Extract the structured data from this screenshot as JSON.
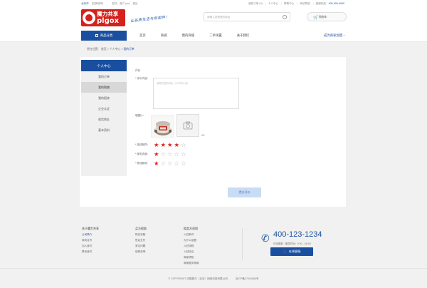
{
  "topbar": {
    "city": "北京市",
    "switch_city": "[切换城市]",
    "welcome": "您好，用户 (sn)",
    "logout": "退出",
    "my_orders": "我的订单 (0)",
    "personal_center": "个人中心",
    "help_center": "帮助中心",
    "network_nav": "网站导航",
    "hotline_label": "客服热线：",
    "hotline": "400-400-4000"
  },
  "header": {
    "logo_cn": "魔力共享",
    "logo_en": "plgox",
    "slogan": "让品质生活与你相伴！",
    "search_placeholder": "请输入您想找的商品",
    "cart_label": "购物车"
  },
  "nav": {
    "category_label": "商品分类",
    "links": [
      "首页",
      "商城",
      "我的商城",
      "二手闲置",
      "关于我们"
    ],
    "business_link": "成为商家加盟"
  },
  "breadcrumb": {
    "prefix": "所在位置：",
    "home": "首页",
    "sep": ">",
    "personal": "个人中心",
    "current": "我的订单"
  },
  "sidebar": {
    "title": "个人中心",
    "items": [
      {
        "label": "我的订单"
      },
      {
        "label": "我的购物"
      },
      {
        "label": "我的报修"
      },
      {
        "label": "企业认证"
      },
      {
        "label": "收货地址"
      },
      {
        "label": "基本资料"
      }
    ]
  },
  "form": {
    "section_title": "评价",
    "content_label": "* 评价内容：",
    "content_placeholder": "请填写您的评价（200字以内）",
    "image_label": "晒图片：",
    "image_count": "0/5",
    "ratings": [
      {
        "label": "* 描述相符：",
        "value": 4,
        "max": 5
      },
      {
        "label": "* 服务态度：",
        "value": 1,
        "max": 5
      },
      {
        "label": "* 物流服务：",
        "value": 1,
        "max": 5
      }
    ],
    "submit_label": "提交评价"
  },
  "footer": {
    "columns": [
      {
        "title": "关于魔力共享",
        "items": [
          "公司简介",
          "商务合作",
          "加入我们",
          "联系我们"
        ]
      },
      {
        "title": "买方帮助",
        "items": [
          "购买流程",
          "售后支付",
          "常见问题",
          "保修说明"
        ]
      },
      {
        "title": "租卖方须知",
        "items": [
          "入驻条件",
          "为什么加盟",
          "入驻流程",
          "入驻协议",
          "商家须知",
          "商家服务条款"
        ]
      }
    ],
    "phone": "400-123-1234",
    "hours": "在线客服（服务时间：9:00 - 18:00）",
    "service_button": "在线客服"
  },
  "copyright": {
    "text": "© COPYRIGHT 无限魔力（北京）网络科技有限公司",
    "icp": "京ICP备17041584号"
  },
  "colors": {
    "brand_blue": "#1a4fa0",
    "brand_red": "#d6201b",
    "star_active": "#e0261c"
  }
}
